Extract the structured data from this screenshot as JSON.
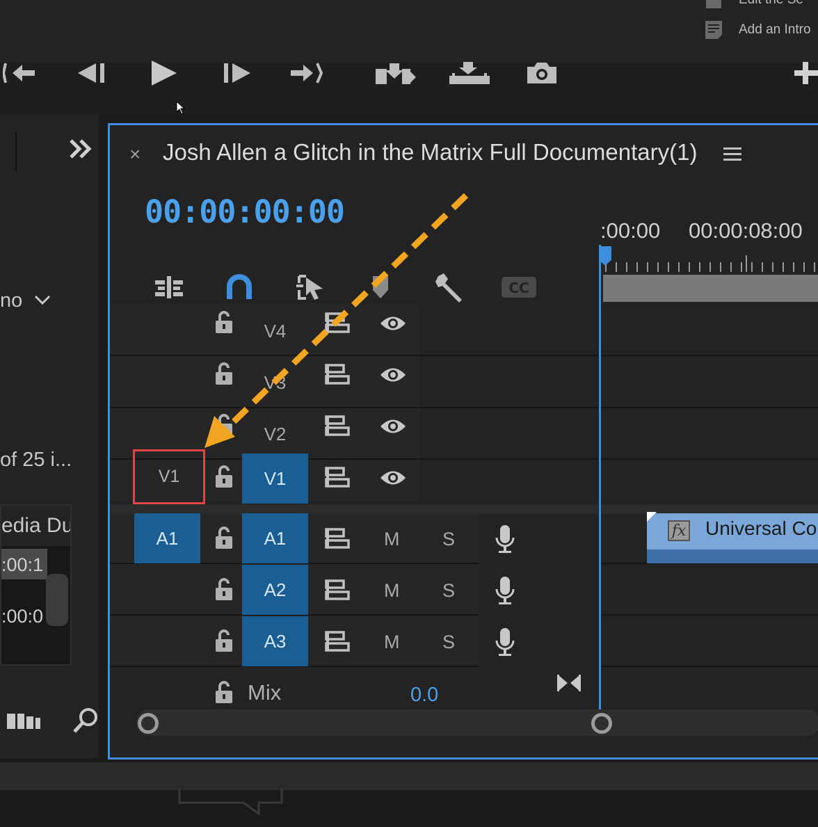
{
  "top_menu": {
    "item1_label": "Edit the Se",
    "item2_label": "Add an Intro"
  },
  "transport": {
    "buttons": [
      "go-to-in-icon",
      "step-back-icon",
      "play-icon",
      "step-forward-icon",
      "go-to-out-icon",
      "insert-icon",
      "overwrite-icon",
      "export-frame-icon",
      "add-button-icon"
    ]
  },
  "left_panel": {
    "dropdown_text": "no",
    "count_text": "of 25 i...",
    "media_header": "edia Du",
    "media_row1": ":00:1",
    "media_row2": ":00:0"
  },
  "timeline": {
    "title": "Josh Allen a Glitch in the Matrix Full Documentary(1)",
    "timecode": "00:00:00:00",
    "ruler_tc1": ":00:00",
    "ruler_tc2": "00:00:08:00",
    "source_patch": "V1",
    "video_tracks": [
      {
        "name": "V4",
        "targeted": false
      },
      {
        "name": "V3",
        "targeted": false
      },
      {
        "name": "V2",
        "targeted": false
      },
      {
        "name": "V1",
        "targeted": true
      }
    ],
    "audio_tracks": [
      {
        "name": "A1",
        "source": "A1",
        "mute": "M",
        "solo": "S"
      },
      {
        "name": "A2",
        "source": "",
        "mute": "M",
        "solo": "S"
      },
      {
        "name": "A3",
        "source": "",
        "mute": "M",
        "solo": "S"
      }
    ],
    "mix_label": "Mix",
    "mix_value": "0.0",
    "clip": {
      "fx_label": "fx",
      "name": "Universal Cou"
    }
  },
  "colors": {
    "accent": "#3d8ee0",
    "timecode": "#4aa0ea",
    "target_patch": "#1a5e94",
    "highlight_box": "#e04646",
    "annotation_arrow": "#f2a521",
    "clip": "#7aa7d8"
  }
}
